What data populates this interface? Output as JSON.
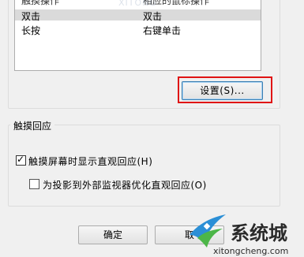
{
  "gesture_table": {
    "header": {
      "col1": "触摸操作",
      "col2": "相应的鼠标操作"
    },
    "rows": [
      {
        "touch": "双击",
        "mouse": "双击"
      },
      {
        "touch": "长按",
        "mouse": "右键单击"
      }
    ]
  },
  "settings_button": "设置(S)...",
  "touch_feedback": {
    "title": "触摸回应",
    "show_visual_feedback": {
      "label": "触摸屏幕时显示直观回应(H)",
      "checked": true
    },
    "optimize_for_projection": {
      "label": "为投影到外部监视器优化直观回应(O)",
      "checked": false
    }
  },
  "footer": {
    "ok": "确定",
    "cancel": "取"
  },
  "watermark": {
    "top_text": "XITONG",
    "brand": "系统城",
    "url": "xitongcheng.com"
  },
  "colors": {
    "highlight_border": "#e01414",
    "logo_blue": "#2b8fd6",
    "logo_green": "#4cb648"
  }
}
